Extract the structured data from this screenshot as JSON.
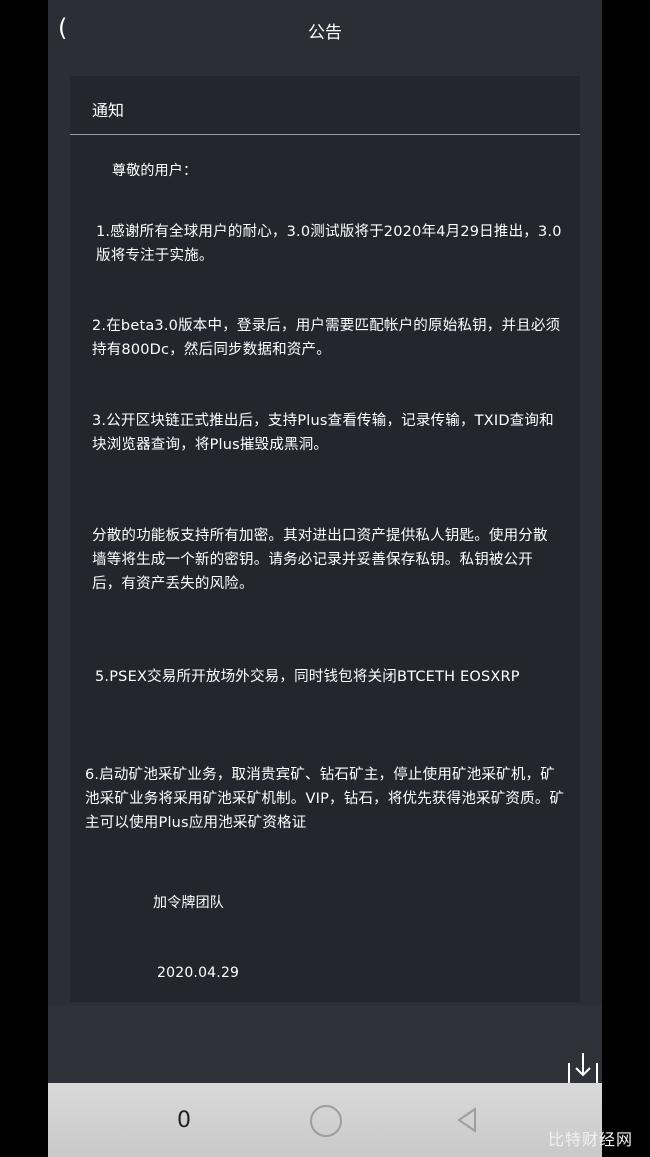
{
  "header": {
    "back_label": "(",
    "title": "公告"
  },
  "notice": {
    "title": "通知",
    "greeting": "尊敬的用户：",
    "paragraphs": [
      "1.感谢所有全球用户的耐心，3.0测试版将于2020年4月29日推出，3.0版将专注于实施。",
      "2.在beta3.0版本中，登录后，用户需要匹配帐户的原始私钥，并且必须持有800Dc，然后同步数据和资产。",
      "3.公开区块链正式推出后，支持Plus查看传输，记录传输，TXID查询和块浏览器查询，将Plus摧毁成黑洞。",
      "分散的功能板支持所有加密。其对进出口资产提供私人钥匙。使用分散墙等将生成一个新的密钥。请务必记录并妥善保存私钥。私钥被公开后，有资产丢失的风险。",
      "5.PSEX交易所开放场外交易，同时钱包将关闭BTCETH EOSXRP",
      "6.启动矿池采矿业务，取消贵宾矿、钻石矿主，停止使用矿池采矿机，矿池采矿业务将采用矿池采矿机制。VIP，钻石，将优先获得池采矿资质。矿主可以使用Plus应用池采矿资格证"
    ],
    "signature": "加令牌团队",
    "date": "2020.04.29"
  },
  "navbar": {
    "menu_label": "0"
  },
  "watermark": "比特财经网",
  "icons": {
    "download": "download-icon",
    "home": "circle-home-icon",
    "back": "triangle-back-icon"
  }
}
